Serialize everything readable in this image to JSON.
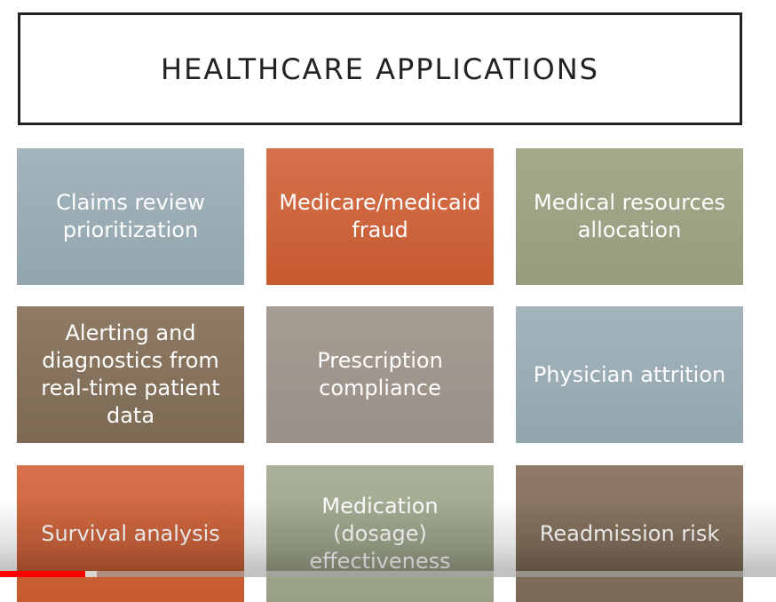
{
  "slide": {
    "title": "HEALTHCARE APPLICATIONS",
    "tiles": [
      {
        "label": "Claims review prioritization",
        "color": "#9aacb4"
      },
      {
        "label": "Medicare/medicaid fraud",
        "color": "#cc6438"
      },
      {
        "label": "Medical resources allocation",
        "color": "#9fa284"
      },
      {
        "label": "Alerting and diagnostics from real-time patient data",
        "color": "#86725c"
      },
      {
        "label": "Prescription compliance",
        "color": "#a0968d"
      },
      {
        "label": "Physician attrition",
        "color": "#9aacb4"
      },
      {
        "label": "Survival analysis",
        "color": "#cc6438"
      },
      {
        "label": "Medication (dosage) effectiveness",
        "color": "#a1a98f"
      },
      {
        "label": "Readmission risk",
        "color": "#86725e"
      }
    ]
  },
  "player": {
    "progress_fraction": 0.11,
    "buffered_fraction": 0.125,
    "progress_color": "#ff0000"
  }
}
